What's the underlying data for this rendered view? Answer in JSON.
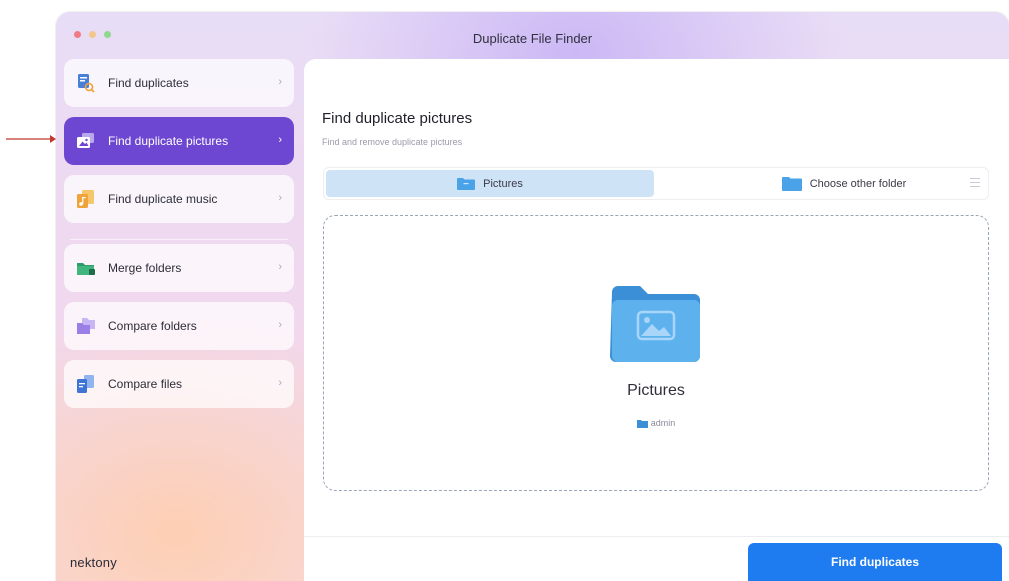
{
  "window": {
    "title": "Duplicate File Finder",
    "brand": "nektony"
  },
  "sidebar": {
    "items": [
      {
        "label": "Find duplicates",
        "icon": "doc-search-icon",
        "active": false
      },
      {
        "label": "Find duplicate pictures",
        "icon": "pictures-icon",
        "active": true
      },
      {
        "label": "Find duplicate music",
        "icon": "music-icon",
        "active": false
      },
      {
        "label": "Merge folders",
        "icon": "merge-folders-icon",
        "active": false
      },
      {
        "label": "Compare folders",
        "icon": "compare-folders-icon",
        "active": false
      },
      {
        "label": "Compare files",
        "icon": "compare-files-icon",
        "active": false
      }
    ],
    "chevron": "›"
  },
  "main": {
    "title": "Find duplicate pictures",
    "subtitle": "Find and remove duplicate pictures",
    "tabs": {
      "selected": "Pictures",
      "other": "Choose other folder"
    },
    "dropzone": {
      "folder_name": "Pictures",
      "owner": "admin"
    },
    "action_button": "Find duplicates"
  },
  "colors": {
    "accent": "#6d47d2",
    "primary_button": "#1f7cf0",
    "selected_tab": "#cfe3f7",
    "annotation_arrow": "#c0392b"
  }
}
